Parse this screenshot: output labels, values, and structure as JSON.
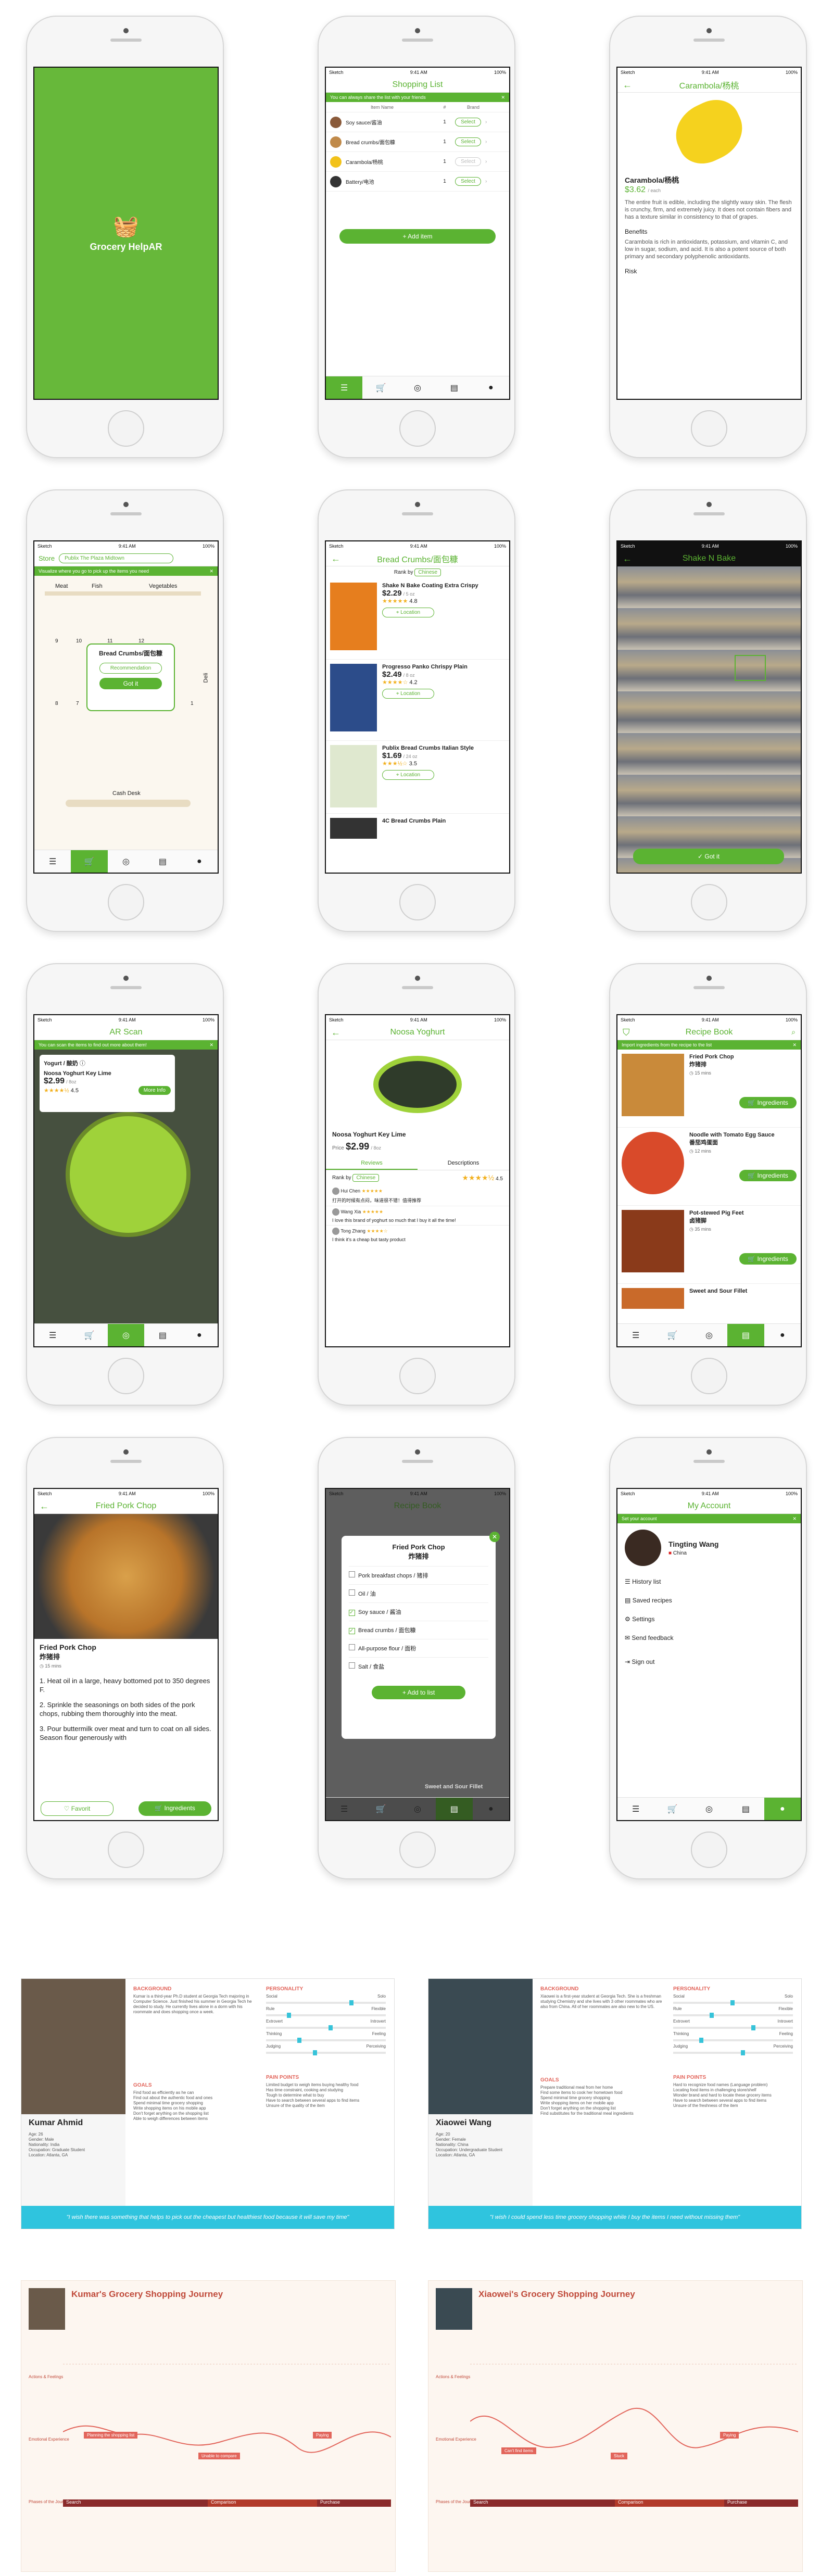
{
  "colors": {
    "brand": "#5bb332",
    "persona_accent": "#2fc4de",
    "journey_accent": "#e2655b"
  },
  "status": {
    "carrier": "Sketch",
    "time": "9:41 AM",
    "battery": "100%"
  },
  "splash": {
    "app_name": "Grocery HelpAR",
    "logo_icon": "basket-icon"
  },
  "shopping_list": {
    "title": "Shopping List",
    "banner": "You can always share the list with your friends",
    "col_item": "Item Name",
    "col_qty": "#",
    "col_brand": "Brand",
    "items": [
      {
        "name": "Soy sauce/酱油",
        "qty": "1",
        "brand": "Select"
      },
      {
        "name": "Bread crumbs/面包糠",
        "qty": "1",
        "brand": "Select"
      },
      {
        "name": "Carambola/杨桃",
        "qty": "1",
        "brand": "Select"
      },
      {
        "name": "Battery/电池",
        "qty": "1",
        "brand": "Select"
      }
    ],
    "add_button": "+ Add item"
  },
  "carambola": {
    "title": "Carambola/杨桃",
    "name": "Carambola/杨桃",
    "price": "$3.62",
    "unit": "/ each",
    "desc": "The entire fruit is edible, including the slightly waxy skin. The flesh is crunchy, firm, and extremely juicy. It does not contain fibers and has a texture similar in consistency to that of grapes.",
    "benefits_title": "Benefits",
    "benefits": "Carambola is rich in antioxidants, potassium, and vitamin C, and low in sugar, sodium, and acid. It is also a potent source of both primary and secondary polyphenolic antioxidants.",
    "risk_title": "Risk"
  },
  "store_map": {
    "store_label": "Store",
    "store_value": "Publix The Plaza Midtown",
    "banner": "Visualize where you go to pick up the items you need",
    "aisles": [
      "Meat",
      "Fish",
      "Vegetables",
      "Deli"
    ],
    "aisle_numbers": [
      "9",
      "10",
      "11",
      "12",
      "8",
      "7",
      "3",
      "2",
      "1"
    ],
    "popup_title": "Bread Crumbs/面包糠",
    "popup_btn1": "Recommendation",
    "popup_btn2": "Got it",
    "cash_desk": "Cash Desk"
  },
  "bread_crumbs": {
    "title": "Bread Crumbs/面包糠",
    "rank_by": "Rank by",
    "rank_value": "Chinese",
    "products": [
      {
        "name": "Shake N Bake Coating Extra Crispy",
        "price": "$2.29",
        "unit": "/ 5 oz",
        "rating": "4.8",
        "button": "Location"
      },
      {
        "name": "Progresso Panko Chrispy Plain",
        "price": "$2.49",
        "unit": "/ 8 oz",
        "rating": "4.2",
        "button": "Location"
      },
      {
        "name": "Publix Bread Crumbs Italian Style",
        "price": "$1.69",
        "unit": "/ 24 oz",
        "rating": "3.5",
        "button": "Location"
      },
      {
        "name": "4C Bread Crumbs Plain",
        "price": "",
        "unit": "",
        "rating": "",
        "button": ""
      }
    ]
  },
  "shake_n_bake": {
    "title": "Shake N Bake",
    "button": "Got it"
  },
  "ar_scan": {
    "title": "AR Scan",
    "banner": "You can scan the items to find out more about them!",
    "card_category": "Yogurt / 酸奶",
    "card_name": "Noosa Yoghurt Key Lime",
    "card_price": "$2.99",
    "card_unit": "/ 8oz",
    "card_rating": "4.5",
    "card_button": "More Info"
  },
  "noosa": {
    "title": "Noosa Yoghurt",
    "name": "Noosa Yoghurt Key Lime",
    "price_label": "Price",
    "price": "$2.99",
    "unit": "/ 8oz",
    "tab_reviews": "Reviews",
    "tab_desc": "Descriptions",
    "rank_by": "Rank by",
    "rank_value": "Chinese",
    "rating": "4.5",
    "reviews": [
      {
        "user": "Hui Chen",
        "text": "打开的时候有点闷，味道很不错！值得推荐"
      },
      {
        "user": "Wang Xia",
        "text": "I love this brand of yoghurt so much that I buy it all the time!"
      },
      {
        "user": "Tong Zhang",
        "text": "I think it's a cheap but tasty product"
      }
    ]
  },
  "recipe_book": {
    "title": "Recipe Book",
    "banner": "Import ingredients from the recipe to the list",
    "recipes": [
      {
        "name": "Fried Pork Chop",
        "cn": "炸猪排",
        "time": "15 mins",
        "button": "Ingredients"
      },
      {
        "name": "Noodle with Tomato Egg Sauce",
        "cn": "番茄鸡蛋面",
        "time": "12 mins",
        "button": "Ingredients"
      },
      {
        "name": "Pot-stewed Pig Feet",
        "cn": "卤猪脚",
        "time": "35 mins",
        "button": "Ingredients"
      },
      {
        "name": "Sweet and Sour Fillet",
        "cn": "",
        "time": "",
        "button": ""
      }
    ]
  },
  "fried_pork": {
    "title": "Fried Pork Chop",
    "name": "Fried Pork Chop",
    "cn": "炸猪排",
    "time": "15 mins",
    "steps": [
      "1. Heat oil in a large, heavy bottomed pot to 350 degrees F.",
      "2. Sprinkle the seasonings on both sides of the pork chops, rubbing them thoroughly into the meat.",
      "3. Pour buttermilk over meat and turn to coat on all sides. Season flour generously with"
    ],
    "favorite": "Favorit",
    "ingredients": "Ingredients"
  },
  "add_list_modal": {
    "title": "Fried Pork Chop",
    "cn": "炸猪排",
    "bg_title": "Recipe Book",
    "items": [
      {
        "label": "Pork breakfast chops / 猪排",
        "checked": false
      },
      {
        "label": "Oil / 油",
        "checked": false
      },
      {
        "label": "Soy sauce / 酱油",
        "checked": true
      },
      {
        "label": "Bread crumbs / 面包糠",
        "checked": true
      },
      {
        "label": "All-purpose flour / 面粉",
        "checked": false
      },
      {
        "label": "Salt / 食盐",
        "checked": false
      }
    ],
    "button": "+ Add to list",
    "bg_item": "Sweet and Sour Fillet"
  },
  "account": {
    "title": "My Account",
    "banner": "Set your account",
    "user_name": "Tingting Wang",
    "country": "China",
    "menu": [
      "History list",
      "Saved recipes",
      "Settings",
      "Send feedback",
      "Sign out"
    ]
  },
  "personas": [
    {
      "name": "Kumar Ahmid",
      "info": [
        "Age: 26",
        "Gender: Male",
        "Nationality: India",
        "Occupation: Graduate Student",
        "Location: Atlanta, GA"
      ],
      "background_title": "BACKGROUND",
      "background": "Kumar is a third-year Ph.D student at Georgia Tech majoring in Computer Science. Just finished his summer in Georgia Tech he decided to study. He currently lives alone in a dorm with his roommate and does shopping once a week.",
      "goals_title": "GOALS",
      "goals": [
        "Find food as efficiently as he can",
        "Find out about the authentic food and ones",
        "Spend minimal time grocery shopping",
        "Write shopping items on his mobile app",
        "Don't forget anything on the shopping list",
        "Able to weigh differences between items"
      ],
      "personality_title": "PERSONALITY",
      "traits": [
        [
          "Social",
          "Solo"
        ],
        [
          "Rule",
          "Flexible"
        ],
        [
          "Extrovert",
          "Introvert"
        ],
        [
          "Thinking",
          "Feeling"
        ],
        [
          "Judging",
          "Perceiving"
        ]
      ],
      "pain_title": "PAIN POINTS",
      "pains": [
        "Limited budget to weigh items buying healthy food",
        "Has time constraint, cooking and studying",
        "Tough to determine what to buy",
        "Have to search between several apps to find items",
        "Unsure of the quality of the item"
      ],
      "quote": "\"I wish there was something that helps to pick out the cheapest but healthiest food because it will save my time\""
    },
    {
      "name": "Xiaowei Wang",
      "info": [
        "Age: 20",
        "Gender: Female",
        "Nationality: China",
        "Occupation: Undergraduate Student",
        "Location: Atlanta, GA"
      ],
      "background_title": "BACKGROUND",
      "background": "Xiaowei is a first-year student at Georgia Tech. She is a freshman studying Chemistry and she lives with 3 other roommates who are also from China. All of her roommates are also new to the US.",
      "goals_title": "GOALS",
      "goals": [
        "Prepare traditional meal from her home",
        "Find some items to cook her hometown food",
        "Spend minimal time grocery shopping",
        "Write shopping items on her mobile app",
        "Don't forget anything on the shopping list",
        "Find substitutes for the traditional meal ingredients"
      ],
      "personality_title": "PERSONALITY",
      "traits": [
        [
          "Social",
          "Solo"
        ],
        [
          "Rule",
          "Flexible"
        ],
        [
          "Extrovert",
          "Introvert"
        ],
        [
          "Thinking",
          "Feeling"
        ],
        [
          "Judging",
          "Perceiving"
        ]
      ],
      "pain_title": "PAIN POINTS",
      "pains": [
        "Hard to recognize food names (Language problem)",
        "Locating food items in challenging store/shelf",
        "Wonder brand and hard to locate these grocery items",
        "Have to search between several apps to find items",
        "Unsure of the freshness of the item"
      ],
      "quote": "\"I wish I could spend less time grocery shopping while I buy the items I need without missing them\""
    }
  ],
  "journeys": [
    {
      "title": "Kumar's Grocery Shopping Journey",
      "rows": [
        "Actions & Feelings",
        "Emotional Experience",
        "Phases of the Journey"
      ],
      "phases": [
        "Search",
        "Comparison",
        "Purchase"
      ],
      "callouts": [
        "Planning the shopping list",
        "Unable to compare",
        "Paying"
      ]
    },
    {
      "title": "Xiaowei's Grocery Shopping Journey",
      "rows": [
        "Actions & Feelings",
        "Emotional Experience",
        "Phases of the Journey"
      ],
      "phases": [
        "Search",
        "Comparison",
        "Purchase"
      ],
      "callouts": [
        "Can't find items",
        "Stuck",
        "Paying"
      ]
    }
  ]
}
